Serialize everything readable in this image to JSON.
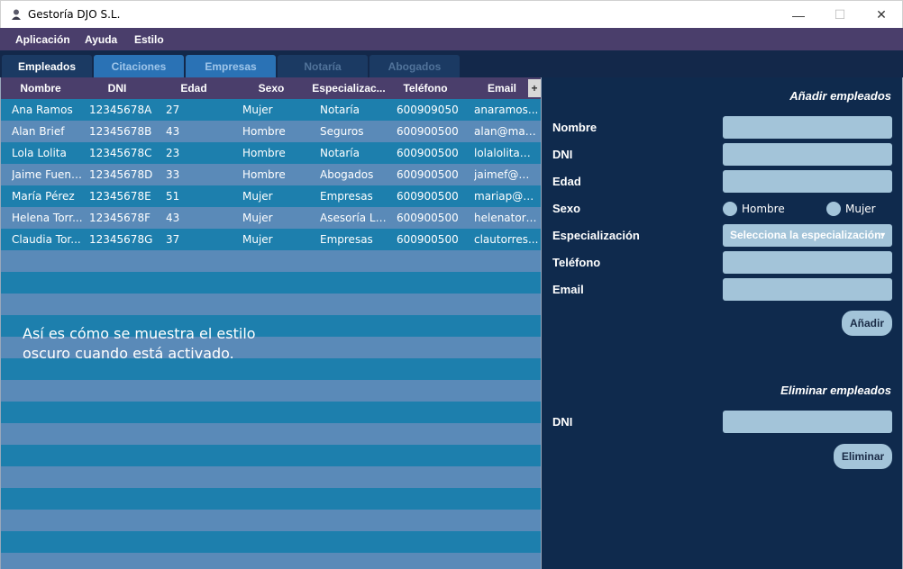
{
  "window": {
    "title": "Gestoría DJO S.L.",
    "min": "—",
    "max": "☐",
    "close": "✕"
  },
  "menu": [
    "Aplicación",
    "Ayuda",
    "Estilo"
  ],
  "tabs": [
    "Empleados",
    "Citaciones",
    "Empresas",
    "Notaría",
    "Abogados"
  ],
  "table": {
    "headers": [
      "Nombre",
      "DNI",
      "Edad",
      "Sexo",
      "Especializac...",
      "Teléfono",
      "Email"
    ],
    "add_column": "+",
    "rows": [
      [
        "Ana Ramos",
        "12345678A",
        "27",
        "Mujer",
        "Notaría",
        "600909050",
        "anaramos..."
      ],
      [
        "Alan Brief",
        "12345678B",
        "43",
        "Hombre",
        "Seguros",
        "600900500",
        "alan@mail...."
      ],
      [
        "Lola Lolita",
        "12345678C",
        "23",
        "Hombre",
        "Notaría",
        "600900500",
        "lolalolita@..."
      ],
      [
        "Jaime Fuent...",
        "12345678D",
        "33",
        "Hombre",
        "Abogados",
        "600900500",
        "jaimef@mai..."
      ],
      [
        "María Pérez",
        "12345678E",
        "51",
        "Mujer",
        "Empresas",
        "600900500",
        "mariap@m..."
      ],
      [
        "Helena Torr...",
        "12345678F",
        "43",
        "Mujer",
        "Asesoría La...",
        "600900500",
        "helenatorre..."
      ],
      [
        "Claudia Tor...",
        "12345678G",
        "37",
        "Mujer",
        "Empresas",
        "600900500",
        "clautorres..."
      ]
    ],
    "overlay_line1": "Así es cómo se muestra el estilo",
    "overlay_line2": "oscuro cuando está activado."
  },
  "add_form": {
    "title": "Añadir empleados",
    "labels": {
      "nombre": "Nombre",
      "dni": "DNI",
      "edad": "Edad",
      "sexo": "Sexo",
      "especializacion": "Especialización",
      "telefono": "Teléfono",
      "email": "Email"
    },
    "sexo_options": [
      "Hombre",
      "Mujer"
    ],
    "especializacion_selected": "Selecciona la especialización.",
    "submit": "Añadir"
  },
  "delete_form": {
    "title": "Eliminar empleados",
    "label": "DNI",
    "submit": "Eliminar"
  },
  "colors": {
    "menu_bg": "#4a3e6b",
    "panel_bg": "#0f2a4d",
    "row_dark": "#1d7fad",
    "row_light": "#5a8ab8",
    "field": "#a3c4d9"
  }
}
